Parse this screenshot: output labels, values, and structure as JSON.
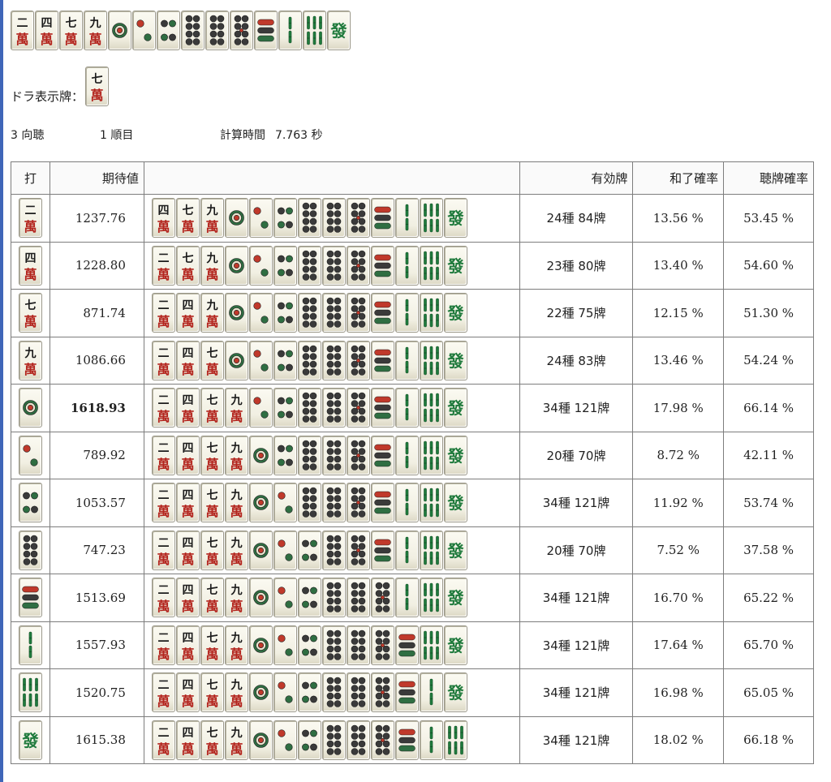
{
  "hand": [
    "m2",
    "m4",
    "m7",
    "m9",
    "p1",
    "p2",
    "p4",
    "p7",
    "p8",
    "p9",
    "s6",
    "s2",
    "s8",
    "hatsu"
  ],
  "dora": {
    "label": "ドラ表示牌：",
    "tile": "m7"
  },
  "info": {
    "shanten": "3 向聴",
    "turn": "1 順目",
    "calc_label": "計算時間",
    "calc_value": "7.763 秒"
  },
  "table": {
    "headers": {
      "discard": "打",
      "ev": "期待値",
      "remain": "",
      "effective": "有効牌",
      "win": "和了確率",
      "tenpai": "聴牌確率"
    },
    "rows": [
      {
        "discard": "m2",
        "ev": "1237.76",
        "bold": false,
        "effective": "24種 84牌",
        "win": "13.56 %",
        "tenpai": "53.45 %",
        "remaining": [
          "m4",
          "m7",
          "m9",
          "p1",
          "p2",
          "p4",
          "p7",
          "p8",
          "p9",
          "s6",
          "s2",
          "s8",
          "hatsu"
        ]
      },
      {
        "discard": "m4",
        "ev": "1228.80",
        "bold": false,
        "effective": "23種 80牌",
        "win": "13.40 %",
        "tenpai": "54.60 %",
        "remaining": [
          "m2",
          "m7",
          "m9",
          "p1",
          "p2",
          "p4",
          "p7",
          "p8",
          "p9",
          "s6",
          "s2",
          "s8",
          "hatsu"
        ]
      },
      {
        "discard": "m7",
        "ev": "871.74",
        "bold": false,
        "effective": "22種 75牌",
        "win": "12.15 %",
        "tenpai": "51.30 %",
        "remaining": [
          "m2",
          "m4",
          "m9",
          "p1",
          "p2",
          "p4",
          "p7",
          "p8",
          "p9",
          "s6",
          "s2",
          "s8",
          "hatsu"
        ]
      },
      {
        "discard": "m9",
        "ev": "1086.66",
        "bold": false,
        "effective": "24種 83牌",
        "win": "13.46 %",
        "tenpai": "54.24 %",
        "remaining": [
          "m2",
          "m4",
          "m7",
          "p1",
          "p2",
          "p4",
          "p7",
          "p8",
          "p9",
          "s6",
          "s2",
          "s8",
          "hatsu"
        ]
      },
      {
        "discard": "p1",
        "ev": "1618.93",
        "bold": true,
        "effective": "34種 121牌",
        "win": "17.98 %",
        "tenpai": "66.14 %",
        "remaining": [
          "m2",
          "m4",
          "m7",
          "m9",
          "p2",
          "p4",
          "p7",
          "p8",
          "p9",
          "s6",
          "s2",
          "s8",
          "hatsu"
        ]
      },
      {
        "discard": "p2",
        "ev": "789.92",
        "bold": false,
        "effective": "20種 70牌",
        "win": "8.72 %",
        "tenpai": "42.11 %",
        "remaining": [
          "m2",
          "m4",
          "m7",
          "m9",
          "p1",
          "p4",
          "p7",
          "p8",
          "p9",
          "s6",
          "s2",
          "s8",
          "hatsu"
        ]
      },
      {
        "discard": "p4",
        "ev": "1053.57",
        "bold": false,
        "effective": "34種 121牌",
        "win": "11.92 %",
        "tenpai": "53.74 %",
        "remaining": [
          "m2",
          "m4",
          "m7",
          "m9",
          "p1",
          "p2",
          "p7",
          "p8",
          "p9",
          "s6",
          "s2",
          "s8",
          "hatsu"
        ]
      },
      {
        "discard": "p7",
        "ev": "747.23",
        "bold": false,
        "effective": "20種 70牌",
        "win": "7.52 %",
        "tenpai": "37.58 %",
        "remaining": [
          "m2",
          "m4",
          "m7",
          "m9",
          "p1",
          "p2",
          "p4",
          "p8",
          "p9",
          "s6",
          "s2",
          "s8",
          "hatsu"
        ]
      },
      {
        "discard": "s6",
        "ev": "1513.69",
        "bold": false,
        "effective": "34種 121牌",
        "win": "16.70 %",
        "tenpai": "65.22 %",
        "remaining": [
          "m2",
          "m4",
          "m7",
          "m9",
          "p1",
          "p2",
          "p4",
          "p7",
          "p8",
          "p9",
          "s2",
          "s8",
          "hatsu"
        ]
      },
      {
        "discard": "s2",
        "ev": "1557.93",
        "bold": false,
        "effective": "34種 121牌",
        "win": "17.64 %",
        "tenpai": "65.70 %",
        "remaining": [
          "m2",
          "m4",
          "m7",
          "m9",
          "p1",
          "p2",
          "p4",
          "p7",
          "p8",
          "p9",
          "s6",
          "s8",
          "hatsu"
        ]
      },
      {
        "discard": "s8",
        "ev": "1520.75",
        "bold": false,
        "effective": "34種 121牌",
        "win": "16.98 %",
        "tenpai": "65.05 %",
        "remaining": [
          "m2",
          "m4",
          "m7",
          "m9",
          "p1",
          "p2",
          "p4",
          "p7",
          "p8",
          "p9",
          "s6",
          "s2",
          "hatsu"
        ]
      },
      {
        "discard": "hatsu",
        "ev": "1615.38",
        "bold": false,
        "effective": "34種 121牌",
        "win": "18.02 %",
        "tenpai": "66.18 %",
        "remaining": [
          "m2",
          "m4",
          "m7",
          "m9",
          "p1",
          "p2",
          "p4",
          "p7",
          "p8",
          "p9",
          "s6",
          "s2",
          "s8"
        ]
      }
    ]
  },
  "tile_glyphs": {
    "m2": "二",
    "m4": "四",
    "m7": "七",
    "m9": "九",
    "man_suffix": "萬",
    "hatsu": "發"
  },
  "colors": {
    "man_red": "#b3241d",
    "pin_red": "#c0392b",
    "pin_green": "#2f6e42",
    "pin_dark": "#3a3a3a",
    "sou_green": "#1f7a3c",
    "accent_blue": "#3f66b8"
  }
}
